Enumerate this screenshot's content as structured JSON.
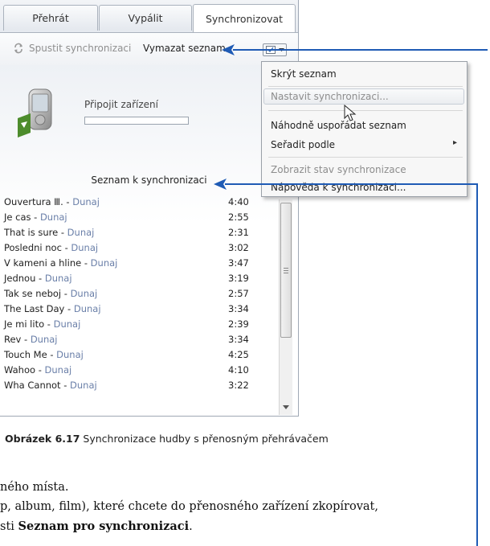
{
  "tabs": [
    "Přehrát",
    "Vypálit",
    "Synchronizovat"
  ],
  "toolbar": {
    "start_sync": "Spustit synchronizaci",
    "clear_list": "Vymazat seznam"
  },
  "device": {
    "connect_label": "Připojit zařízení",
    "progress": 0
  },
  "list": {
    "header": "Seznam k synchronizaci",
    "items": [
      {
        "title": "Ouvertura Ⅲ.",
        "artist": "Dunaj",
        "duration": "4:40"
      },
      {
        "title": "Je cas",
        "artist": "Dunaj",
        "duration": "2:55"
      },
      {
        "title": "That is sure",
        "artist": "Dunaj",
        "duration": "2:31"
      },
      {
        "title": "Posledni noc",
        "artist": "Dunaj",
        "duration": "3:02"
      },
      {
        "title": "V kameni a hline",
        "artist": "Dunaj",
        "duration": "3:47"
      },
      {
        "title": "Jednou",
        "artist": "Dunaj",
        "duration": "3:19"
      },
      {
        "title": "Tak se neboj",
        "artist": "Dunaj",
        "duration": "2:57"
      },
      {
        "title": "The Last Day",
        "artist": "Dunaj",
        "duration": "3:34"
      },
      {
        "title": "Je mi lito",
        "artist": "Dunaj",
        "duration": "2:39"
      },
      {
        "title": "Rev",
        "artist": "Dunaj",
        "duration": "3:34"
      },
      {
        "title": "Touch Me",
        "artist": "Dunaj",
        "duration": "4:25"
      },
      {
        "title": "Wahoo",
        "artist": "Dunaj",
        "duration": "4:10"
      },
      {
        "title": "Wha Cannot",
        "artist": "Dunaj",
        "duration": "3:22"
      }
    ]
  },
  "menu": {
    "items": [
      {
        "label": "Skrýt seznam",
        "disabled": false
      },
      {
        "label": "Nastavit synchronizaci...",
        "disabled": true
      },
      {
        "label": "Náhodně uspořádat seznam",
        "disabled": false
      },
      {
        "label": "Seřadit podle",
        "disabled": false,
        "submenu_arrow": "▸"
      },
      {
        "label": "Zobrazit stav synchronizace",
        "disabled": true
      },
      {
        "label": "Nápověda k synchronizaci...",
        "disabled": false
      }
    ]
  },
  "caption": {
    "label": "Obrázek 6.17",
    "text": " Synchronizace hudby s přenosným přehrávačem"
  },
  "body_text": {
    "line1": "ného místa.",
    "line2": "p, album, film), které chcete do přenosného zařízení zkopírovat,",
    "line3_prefix": "sti ",
    "line3_bold": "Seznam pro synchronizaci",
    "line3_suffix": "."
  },
  "colors": {
    "accent_line": "#1f5bb5",
    "artist_text": "#6a7fa8",
    "disabled_text": "#8d8d8d"
  },
  "icons": [
    "sync-icon",
    "list-options-icon",
    "chevron-down-icon",
    "device-icon",
    "mouse-cursor-icon",
    "arrow-left-icon"
  ]
}
